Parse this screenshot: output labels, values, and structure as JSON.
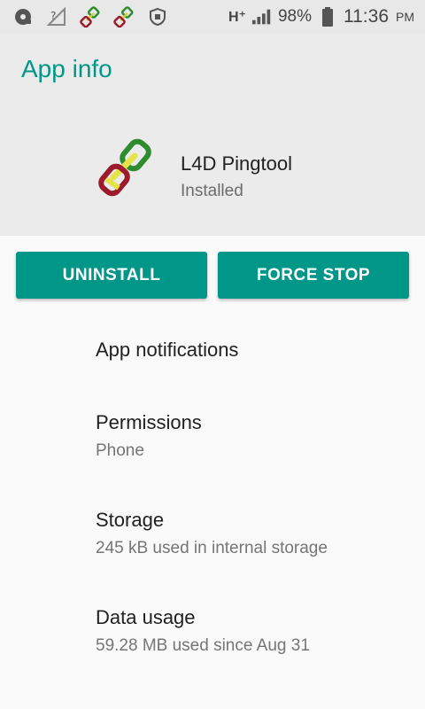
{
  "status_bar": {
    "battery": "98%",
    "time": "11:36",
    "ampm": "PM",
    "network": "H⁺"
  },
  "header": {
    "title": "App info",
    "app_name": "L4D Pingtool",
    "app_status": "Installed"
  },
  "buttons": {
    "uninstall": "UNINSTALL",
    "force_stop": "FORCE STOP"
  },
  "items": [
    {
      "title": "App notifications",
      "subtitle": ""
    },
    {
      "title": "Permissions",
      "subtitle": "Phone"
    },
    {
      "title": "Storage",
      "subtitle": "245 kB used in internal storage"
    },
    {
      "title": "Data usage",
      "subtitle": "59.28 MB used since Aug 31"
    }
  ],
  "colors": {
    "accent": "#009688",
    "icon_green": "#2e8b2e",
    "icon_yellow": "#e6e34a",
    "icon_red": "#9b1b2c"
  }
}
